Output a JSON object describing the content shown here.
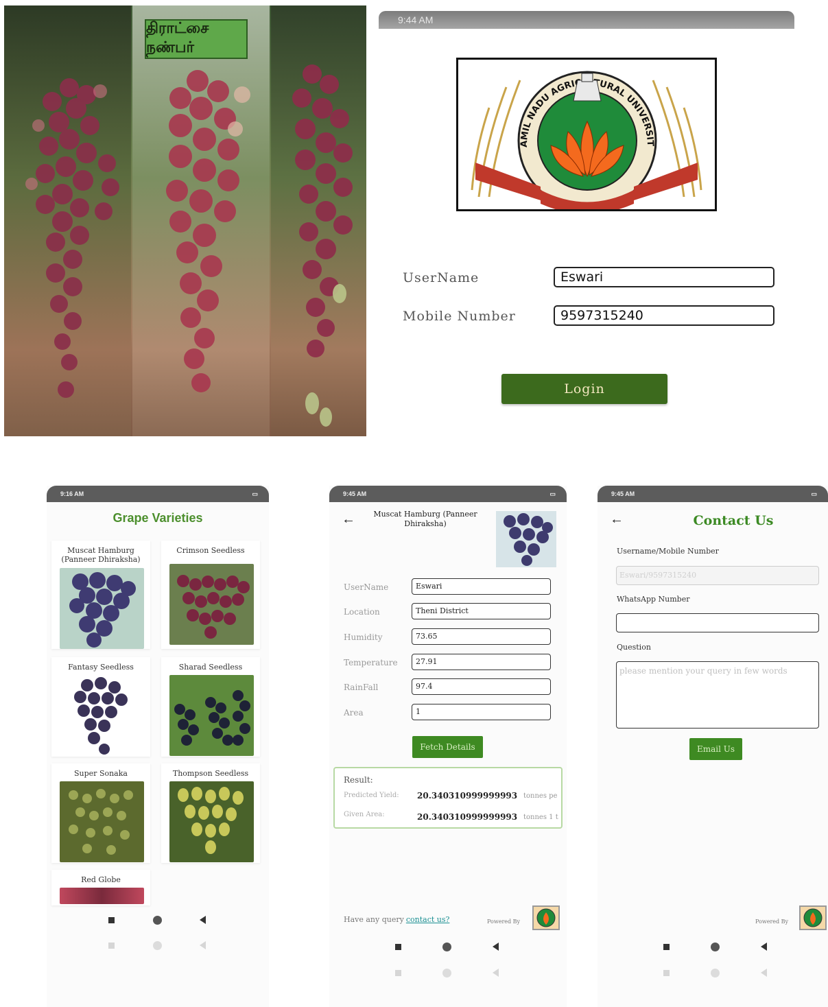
{
  "splash": {
    "title_tamil": "திராட்சை நண்பர்"
  },
  "login": {
    "statusbar_time": "9:44 AM",
    "logo_name": "tnau-logo",
    "logo_ring_text": "TAMIL NADU AGRICULTURAL UNIVERSITY",
    "username_label": "UserName",
    "username_value": "Eswari",
    "mobile_label": "Mobile Number",
    "mobile_value": "9597315240",
    "login_button": "Login",
    "colors": {
      "button_bg": "#3c6a1d",
      "button_text": "#f4e7c0"
    }
  },
  "varieties": {
    "statusbar_time": "9:16 AM",
    "title": "Grape Varieties",
    "items": [
      {
        "name": "Muscat Hamburg (Panneer Dhiraksha)"
      },
      {
        "name": "Crimson Seedless"
      },
      {
        "name": "Fantasy Seedless"
      },
      {
        "name": "Sharad Seedless"
      },
      {
        "name": "Super Sonaka"
      },
      {
        "name": "Thompson Seedless"
      },
      {
        "name": "Red Globe"
      }
    ],
    "title_color": "#4c8f2d"
  },
  "detail": {
    "statusbar_time": "9:45 AM",
    "title": "Muscat Hamburg (Panneer Dhiraksha)",
    "fields": [
      {
        "label": "UserName",
        "value": "Eswari"
      },
      {
        "label": "Location",
        "value": "Theni District"
      },
      {
        "label": "Humidity",
        "value": "73.65"
      },
      {
        "label": "Temperature",
        "value": "27.91"
      },
      {
        "label": "RainFall",
        "value": "97.4"
      },
      {
        "label": "Area",
        "value": "1"
      }
    ],
    "fetch_button": "Fetch Details",
    "result": {
      "heading": "Result:",
      "predicted_label": "Predicted Yield:",
      "predicted_value": "20.340310999999993",
      "predicted_unit": "tonnes pe",
      "area_label": "Given Area:",
      "area_value": "20.340310999999993",
      "area_unit": "tonnes 1 t"
    },
    "footer_query": "Have any query",
    "footer_link": "contact us?",
    "powered_by": "Powered By"
  },
  "contact": {
    "statusbar_time": "9:45 AM",
    "title": "Contact Us",
    "username_label": "Username/Mobile Number",
    "username_value": "Eswari/9597315240",
    "whatsapp_label": "WhatsApp Number",
    "whatsapp_value": "",
    "question_label": "Question",
    "question_placeholder": "please mention your query in few words",
    "email_button": "Email Us",
    "powered_by": "Powered By",
    "title_color": "#3c8a24"
  }
}
